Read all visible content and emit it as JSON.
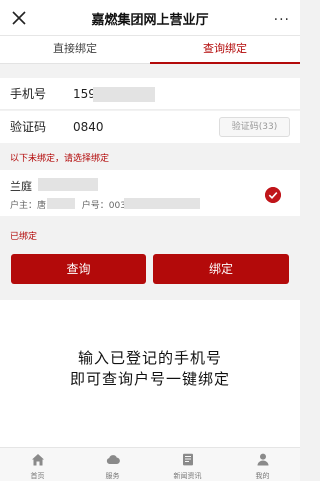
{
  "header": {
    "title": "嘉燃集团网上营业厅",
    "close_icon": "close-icon",
    "more_icon": "more-dots-icon",
    "more_glyph": "···"
  },
  "tabs": [
    {
      "label": "直接绑定",
      "active": false
    },
    {
      "label": "查询绑定",
      "active": true
    }
  ],
  "form": {
    "phone_label": "手机号",
    "phone_value": "159",
    "code_label": "验证码",
    "code_value": "0840",
    "code_button": "验证码(33)"
  },
  "unbound": {
    "note": "以下未绑定，请选择绑定",
    "account": {
      "name": "兰庭",
      "owner_prefix": "户主：唐",
      "account_prefix": "户号：003",
      "selected": true
    }
  },
  "bound": {
    "label": "已绑定"
  },
  "buttons": {
    "query": "查询",
    "bind": "绑定"
  },
  "hint": {
    "line1": "输入已登记的手机号",
    "line2": "即可查询户号一键绑定"
  },
  "tabbar": [
    {
      "label": "首页",
      "icon": "home-icon"
    },
    {
      "label": "服务",
      "icon": "cloud-icon"
    },
    {
      "label": "新闻资讯",
      "icon": "news-icon"
    },
    {
      "label": "我的",
      "icon": "profile-icon"
    }
  ],
  "colors": {
    "accent": "#b30a0a",
    "check": "#c0151a"
  }
}
